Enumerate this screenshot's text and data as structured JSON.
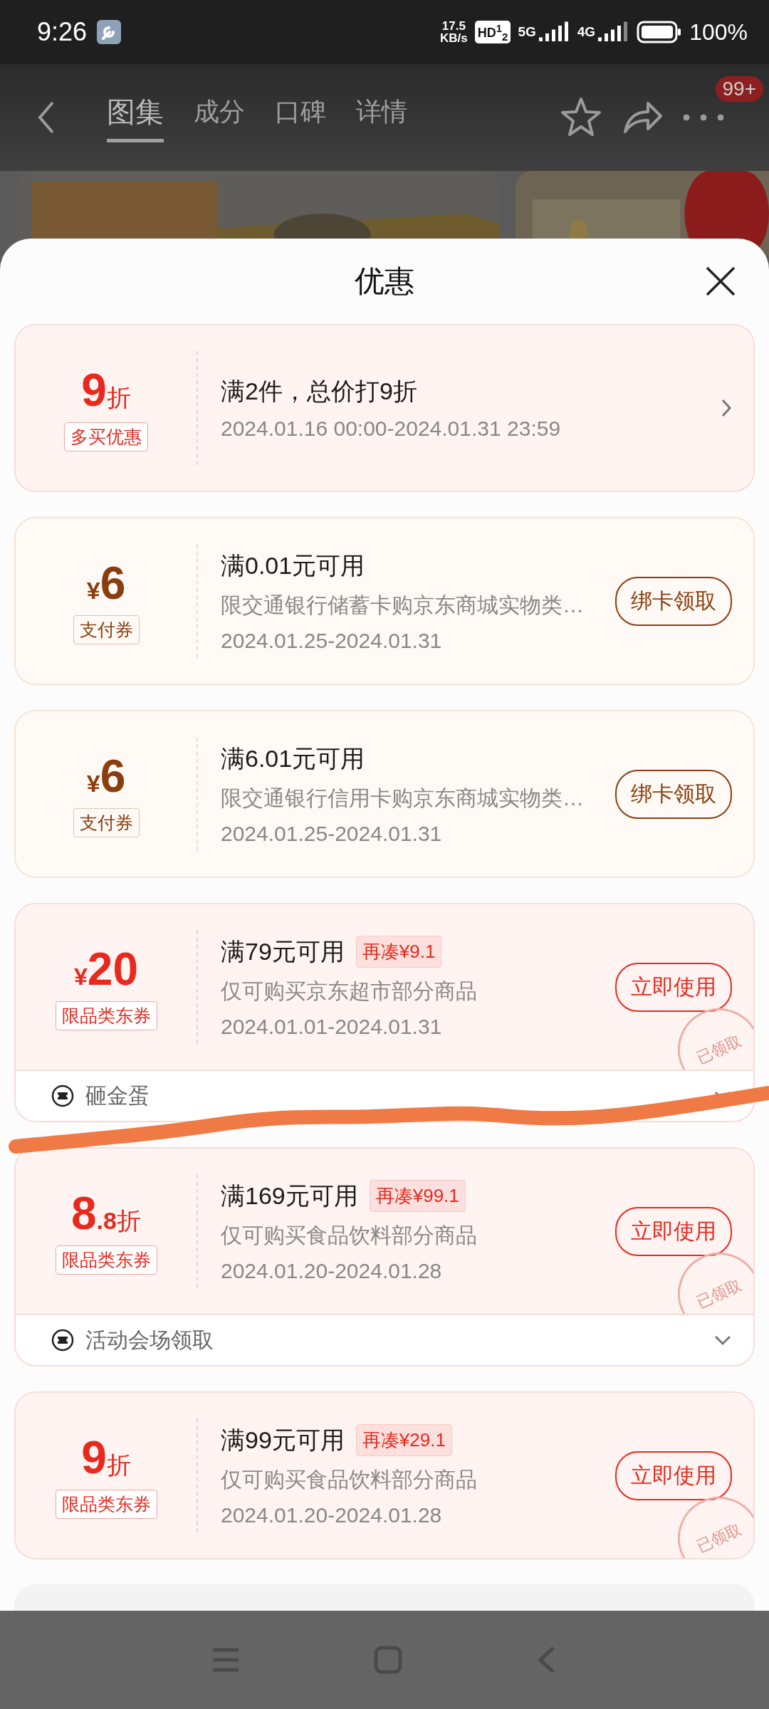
{
  "status_bar": {
    "time": "9:26",
    "net_speed_value": "17.5",
    "net_speed_unit": "KB/s",
    "hd_label": "HD$^{1}$$_{2}$",
    "network_1": "5G",
    "network_2": "4G",
    "battery": "100%"
  },
  "nav": {
    "tabs": [
      {
        "label": "图集",
        "selected": true
      },
      {
        "label": "成分",
        "selected": false
      },
      {
        "label": "口碑",
        "selected": false
      },
      {
        "label": "详情",
        "selected": false
      }
    ],
    "badge": "99+"
  },
  "sheet": {
    "title": "优惠",
    "coupons": [
      {
        "kind": "discount",
        "amount": "9",
        "unit": "折",
        "tag": "多买优惠",
        "title": "满2件，总价打9折",
        "date": "2024.01.16 00:00-2024.01.31 23:59",
        "action": {
          "kind": "chevron"
        },
        "stamp": false
      },
      {
        "kind": "payment",
        "currency": "¥",
        "amount": "6",
        "tag": "支付券",
        "title": "满0.01元可用",
        "desc": "限交通银行储蓄卡购京东商城实物类…",
        "date": "2024.01.25-2024.01.31",
        "action": {
          "kind": "button",
          "label": "绑卡领取"
        },
        "stamp": false
      },
      {
        "kind": "payment",
        "currency": "¥",
        "amount": "6",
        "tag": "支付券",
        "title": "满6.01元可用",
        "desc": "限交通银行信用卡购京东商城实物类…",
        "date": "2024.01.25-2024.01.31",
        "action": {
          "kind": "button",
          "label": "绑卡领取"
        },
        "stamp": false
      },
      {
        "kind": "discount",
        "currency": "¥",
        "amount": "20",
        "tag": "限品类东券",
        "title": "满79元可用",
        "note": "再凑¥9.1",
        "desc": "仅可购买京东超市部分商品",
        "date": "2024.01.01-2024.01.31",
        "action": {
          "kind": "button",
          "label": "立即使用"
        },
        "stamp": "已领取",
        "footer": "砸金蛋"
      },
      {
        "kind": "discount",
        "amount": "8",
        "amount_small": ".8",
        "unit": "折",
        "tag": "限品类东券",
        "title": "满169元可用",
        "note": "再凑¥99.1",
        "desc": "仅可购买食品饮料部分商品",
        "date": "2024.01.20-2024.01.28",
        "action": {
          "kind": "button",
          "label": "立即使用"
        },
        "stamp": "已领取",
        "footer": "活动会场领取"
      },
      {
        "kind": "discount",
        "amount": "9",
        "unit": "折",
        "tag": "限品类东券",
        "title": "满99元可用",
        "note": "再凑¥29.1",
        "desc": "仅可购买食品饮料部分商品",
        "date": "2024.01.20-2024.01.28",
        "action": {
          "kind": "button",
          "label": "立即使用"
        },
        "stamp": "已领取"
      }
    ]
  }
}
